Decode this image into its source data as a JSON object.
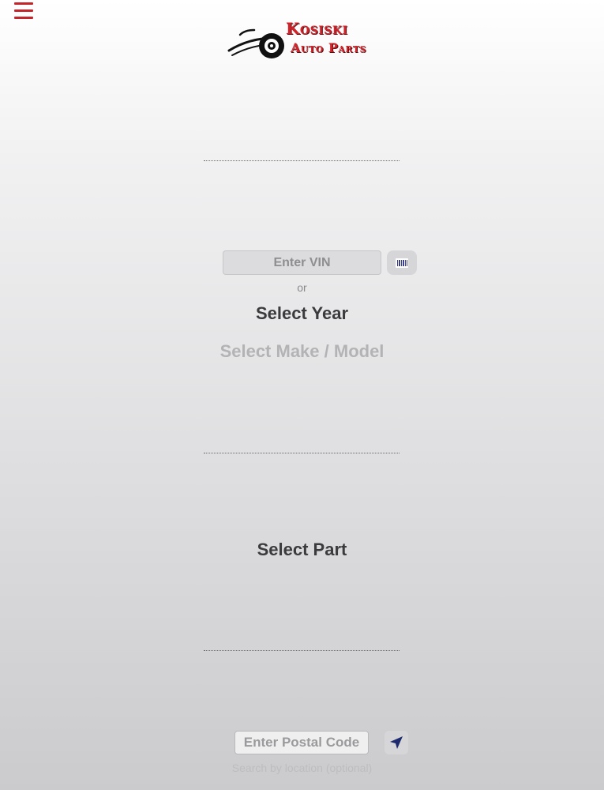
{
  "header": {
    "menu_icon": "hamburger-menu-icon",
    "logo": {
      "line1": "Kosiski",
      "line2": "Auto Parts",
      "icon": "wheel-swoosh-logo",
      "brand_color": "#d2232a"
    }
  },
  "vehicle": {
    "vin": {
      "placeholder": "Enter VIN",
      "value": ""
    },
    "barcode_icon": "barcode-icon",
    "or_label": "or",
    "select_year_label": "Select Year",
    "select_make_model_label": "Select Make / Model"
  },
  "part": {
    "select_part_label": "Select Part"
  },
  "location": {
    "postal_code": {
      "placeholder": "Enter Postal Code",
      "value": ""
    },
    "location_icon": "location-arrow-icon",
    "hint": "Search by location (optional)"
  },
  "colors": {
    "accent": "#c4252b",
    "location_arrow": "#1d2a6e"
  }
}
